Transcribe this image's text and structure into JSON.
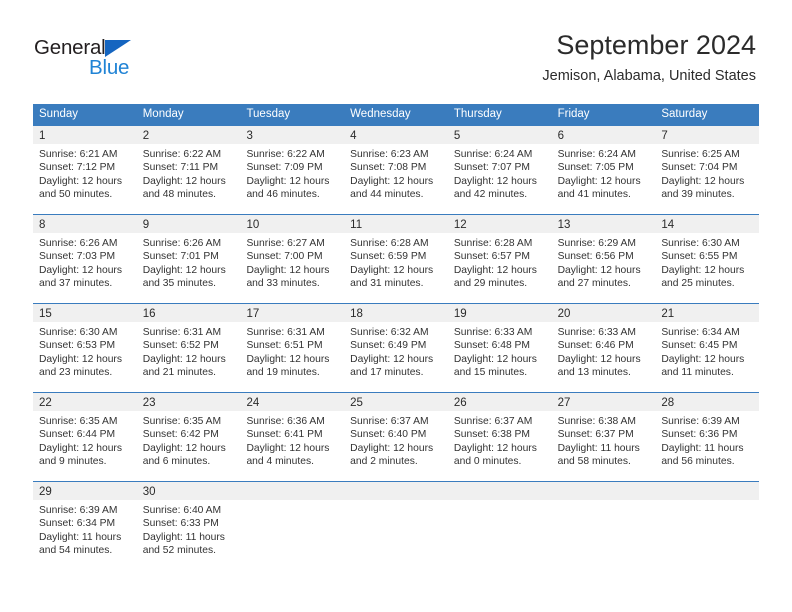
{
  "brand": {
    "name_part1": "General",
    "name_part2": "Blue",
    "triangle_color": "#1565c0",
    "blue_color": "#2083d5"
  },
  "header": {
    "title": "September 2024",
    "subtitle": "Jemison, Alabama, United States"
  },
  "theme": {
    "header_band": "#3a7cbe",
    "daynum_band": "#f0f0f0",
    "text": "#333333"
  },
  "weekdays": [
    "Sunday",
    "Monday",
    "Tuesday",
    "Wednesday",
    "Thursday",
    "Friday",
    "Saturday"
  ],
  "labels": {
    "sunrise_prefix": "Sunrise:",
    "sunset_prefix": "Sunset:",
    "daylight_prefix": "Daylight:"
  },
  "weeks": [
    [
      {
        "day": "1",
        "sunrise": "Sunrise: 6:21 AM",
        "sunset": "Sunset: 7:12 PM",
        "daylight": "Daylight: 12 hours and 50 minutes."
      },
      {
        "day": "2",
        "sunrise": "Sunrise: 6:22 AM",
        "sunset": "Sunset: 7:11 PM",
        "daylight": "Daylight: 12 hours and 48 minutes."
      },
      {
        "day": "3",
        "sunrise": "Sunrise: 6:22 AM",
        "sunset": "Sunset: 7:09 PM",
        "daylight": "Daylight: 12 hours and 46 minutes."
      },
      {
        "day": "4",
        "sunrise": "Sunrise: 6:23 AM",
        "sunset": "Sunset: 7:08 PM",
        "daylight": "Daylight: 12 hours and 44 minutes."
      },
      {
        "day": "5",
        "sunrise": "Sunrise: 6:24 AM",
        "sunset": "Sunset: 7:07 PM",
        "daylight": "Daylight: 12 hours and 42 minutes."
      },
      {
        "day": "6",
        "sunrise": "Sunrise: 6:24 AM",
        "sunset": "Sunset: 7:05 PM",
        "daylight": "Daylight: 12 hours and 41 minutes."
      },
      {
        "day": "7",
        "sunrise": "Sunrise: 6:25 AM",
        "sunset": "Sunset: 7:04 PM",
        "daylight": "Daylight: 12 hours and 39 minutes."
      }
    ],
    [
      {
        "day": "8",
        "sunrise": "Sunrise: 6:26 AM",
        "sunset": "Sunset: 7:03 PM",
        "daylight": "Daylight: 12 hours and 37 minutes."
      },
      {
        "day": "9",
        "sunrise": "Sunrise: 6:26 AM",
        "sunset": "Sunset: 7:01 PM",
        "daylight": "Daylight: 12 hours and 35 minutes."
      },
      {
        "day": "10",
        "sunrise": "Sunrise: 6:27 AM",
        "sunset": "Sunset: 7:00 PM",
        "daylight": "Daylight: 12 hours and 33 minutes."
      },
      {
        "day": "11",
        "sunrise": "Sunrise: 6:28 AM",
        "sunset": "Sunset: 6:59 PM",
        "daylight": "Daylight: 12 hours and 31 minutes."
      },
      {
        "day": "12",
        "sunrise": "Sunrise: 6:28 AM",
        "sunset": "Sunset: 6:57 PM",
        "daylight": "Daylight: 12 hours and 29 minutes."
      },
      {
        "day": "13",
        "sunrise": "Sunrise: 6:29 AM",
        "sunset": "Sunset: 6:56 PM",
        "daylight": "Daylight: 12 hours and 27 minutes."
      },
      {
        "day": "14",
        "sunrise": "Sunrise: 6:30 AM",
        "sunset": "Sunset: 6:55 PM",
        "daylight": "Daylight: 12 hours and 25 minutes."
      }
    ],
    [
      {
        "day": "15",
        "sunrise": "Sunrise: 6:30 AM",
        "sunset": "Sunset: 6:53 PM",
        "daylight": "Daylight: 12 hours and 23 minutes."
      },
      {
        "day": "16",
        "sunrise": "Sunrise: 6:31 AM",
        "sunset": "Sunset: 6:52 PM",
        "daylight": "Daylight: 12 hours and 21 minutes."
      },
      {
        "day": "17",
        "sunrise": "Sunrise: 6:31 AM",
        "sunset": "Sunset: 6:51 PM",
        "daylight": "Daylight: 12 hours and 19 minutes."
      },
      {
        "day": "18",
        "sunrise": "Sunrise: 6:32 AM",
        "sunset": "Sunset: 6:49 PM",
        "daylight": "Daylight: 12 hours and 17 minutes."
      },
      {
        "day": "19",
        "sunrise": "Sunrise: 6:33 AM",
        "sunset": "Sunset: 6:48 PM",
        "daylight": "Daylight: 12 hours and 15 minutes."
      },
      {
        "day": "20",
        "sunrise": "Sunrise: 6:33 AM",
        "sunset": "Sunset: 6:46 PM",
        "daylight": "Daylight: 12 hours and 13 minutes."
      },
      {
        "day": "21",
        "sunrise": "Sunrise: 6:34 AM",
        "sunset": "Sunset: 6:45 PM",
        "daylight": "Daylight: 12 hours and 11 minutes."
      }
    ],
    [
      {
        "day": "22",
        "sunrise": "Sunrise: 6:35 AM",
        "sunset": "Sunset: 6:44 PM",
        "daylight": "Daylight: 12 hours and 9 minutes."
      },
      {
        "day": "23",
        "sunrise": "Sunrise: 6:35 AM",
        "sunset": "Sunset: 6:42 PM",
        "daylight": "Daylight: 12 hours and 6 minutes."
      },
      {
        "day": "24",
        "sunrise": "Sunrise: 6:36 AM",
        "sunset": "Sunset: 6:41 PM",
        "daylight": "Daylight: 12 hours and 4 minutes."
      },
      {
        "day": "25",
        "sunrise": "Sunrise: 6:37 AM",
        "sunset": "Sunset: 6:40 PM",
        "daylight": "Daylight: 12 hours and 2 minutes."
      },
      {
        "day": "26",
        "sunrise": "Sunrise: 6:37 AM",
        "sunset": "Sunset: 6:38 PM",
        "daylight": "Daylight: 12 hours and 0 minutes."
      },
      {
        "day": "27",
        "sunrise": "Sunrise: 6:38 AM",
        "sunset": "Sunset: 6:37 PM",
        "daylight": "Daylight: 11 hours and 58 minutes."
      },
      {
        "day": "28",
        "sunrise": "Sunrise: 6:39 AM",
        "sunset": "Sunset: 6:36 PM",
        "daylight": "Daylight: 11 hours and 56 minutes."
      }
    ],
    [
      {
        "day": "29",
        "sunrise": "Sunrise: 6:39 AM",
        "sunset": "Sunset: 6:34 PM",
        "daylight": "Daylight: 11 hours and 54 minutes."
      },
      {
        "day": "30",
        "sunrise": "Sunrise: 6:40 AM",
        "sunset": "Sunset: 6:33 PM",
        "daylight": "Daylight: 11 hours and 52 minutes."
      },
      {
        "day": "",
        "sunrise": "",
        "sunset": "",
        "daylight": ""
      },
      {
        "day": "",
        "sunrise": "",
        "sunset": "",
        "daylight": ""
      },
      {
        "day": "",
        "sunrise": "",
        "sunset": "",
        "daylight": ""
      },
      {
        "day": "",
        "sunrise": "",
        "sunset": "",
        "daylight": ""
      },
      {
        "day": "",
        "sunrise": "",
        "sunset": "",
        "daylight": ""
      }
    ]
  ]
}
